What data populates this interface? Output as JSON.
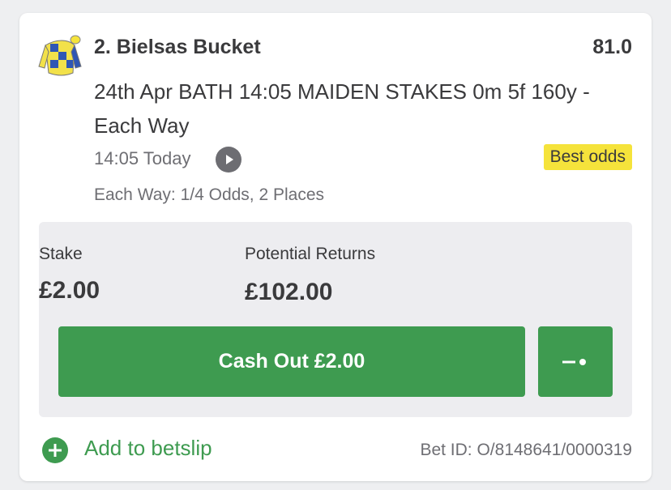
{
  "bet": {
    "selection": "2. Bielsas Bucket",
    "odds": "81.0",
    "market_line1": "24th Apr BATH 14:05 MAIDEN STAKES 0m 5f 160y -",
    "market_line2": "Each Way",
    "race_time": "14:05 Today",
    "badge": "Best odds",
    "each_way_terms": "Each Way: 1/4 Odds, 2 Places"
  },
  "panel": {
    "stake_label": "Stake",
    "stake_value": "£2.00",
    "returns_label": "Potential Returns",
    "returns_value": "£102.00",
    "cashout_label": "Cash Out £2.00"
  },
  "footer": {
    "add_label": "Add to betslip",
    "bet_id": "Bet ID: O/8148641/0000319"
  },
  "icons": {
    "silks": "jockey-silks-icon",
    "play": "play-icon",
    "partial_cashout": "partial-cashout-icon",
    "add": "plus-circle-icon"
  },
  "colors": {
    "accent_green": "#3e9b50",
    "badge_yellow": "#f5e33b",
    "panel_bg": "#ededf0"
  }
}
